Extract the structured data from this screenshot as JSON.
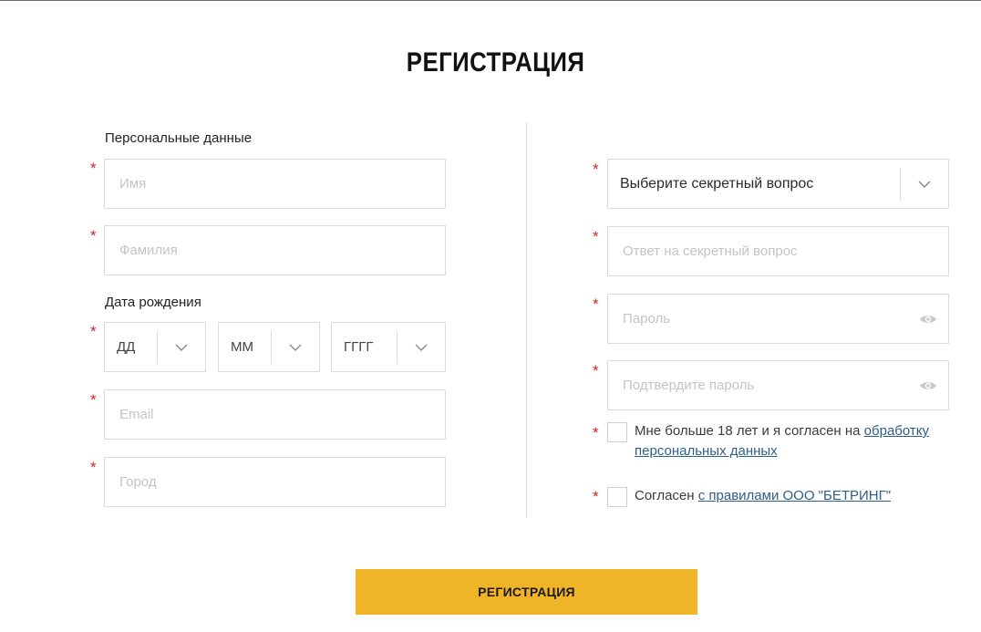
{
  "title": "РЕГИСТРАЦИЯ",
  "personal": {
    "section_label": "Персональные данные",
    "first_name_placeholder": "Имя",
    "last_name_placeholder": "Фамилия",
    "birth_label": "Дата рождения",
    "day": "ДД",
    "month": "ММ",
    "year": "ГГГГ",
    "email_placeholder": "Email",
    "city_placeholder": "Город"
  },
  "security": {
    "question_select": "Выберите секретный вопрос",
    "answer_placeholder": "Ответ на секретный вопрос",
    "password_placeholder": "Пароль",
    "confirm_placeholder": "Подтвердите пароль"
  },
  "consents": {
    "age_text": "Мне больше 18 лет и я согласен на ",
    "age_link_1": "обработку",
    "age_link_2": "персональных данных",
    "rules_text": "Согласен ",
    "rules_link": "с правилами ООО \"БЕТРИНГ\""
  },
  "required_mark": "*",
  "submit_label": "РЕГИСТРАЦИЯ",
  "colors": {
    "accent": "#f0b429",
    "required": "#c62828",
    "link": "#2f5e86",
    "border": "#dcdcdc"
  }
}
